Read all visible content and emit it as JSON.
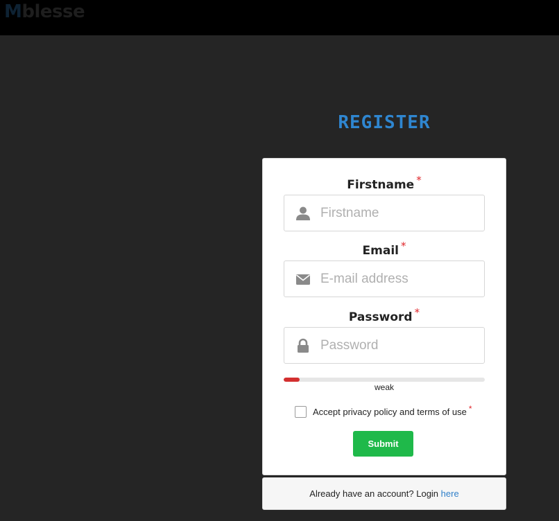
{
  "header": {
    "logo_first": "M",
    "logo_rest": "blesse"
  },
  "page_title": "REGISTER",
  "form": {
    "firstname": {
      "label": "Firstname",
      "required_mark": "*",
      "placeholder": "Firstname",
      "icon": "user-icon"
    },
    "email": {
      "label": "Email",
      "required_mark": "*",
      "placeholder": "E-mail address",
      "icon": "envelope-icon"
    },
    "password": {
      "label": "Password",
      "required_mark": "*",
      "placeholder": "Password",
      "icon": "lock-icon"
    },
    "strength": {
      "label": "weak",
      "level_percent": 8,
      "color": "#d32f2f"
    },
    "terms": {
      "label": "Accept privacy policy and terms of use",
      "required_mark": "*",
      "checked": false
    },
    "submit_label": "Submit"
  },
  "footer": {
    "text": "Already have an account? Login",
    "link_text": "here"
  },
  "colors": {
    "accent": "#2f86d0",
    "submit": "#1fb94a",
    "required": "#e0262b"
  }
}
